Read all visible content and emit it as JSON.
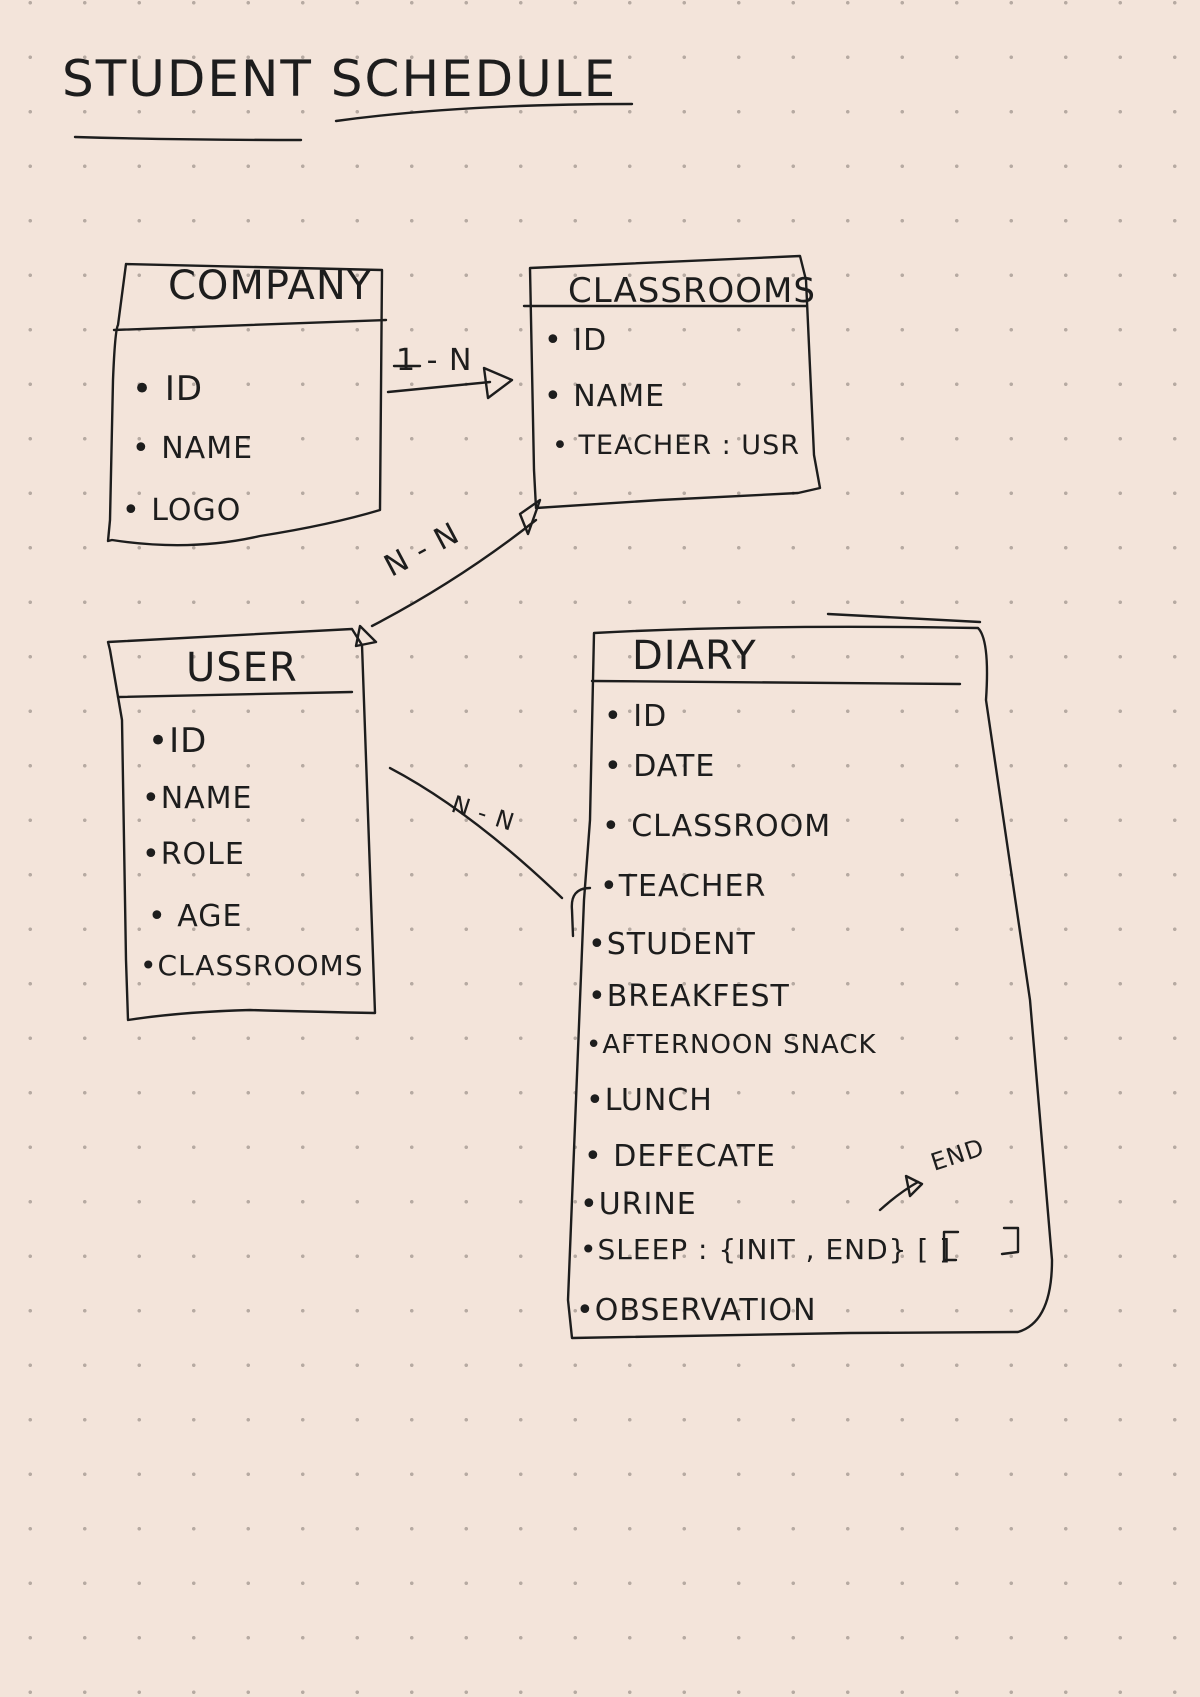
{
  "title": "STUDENT SCHEDULE",
  "entities": {
    "company": {
      "header": "COMPANY",
      "fields": [
        "ID",
        "NAME",
        "LOGO"
      ]
    },
    "classrooms": {
      "header": "CLASSROOMS",
      "fields": [
        "ID",
        "NAME",
        "TEACHER : USR"
      ]
    },
    "user": {
      "header": "USER",
      "fields": [
        "ID",
        "NAME",
        "ROLE",
        "AGE",
        "CLASSROOMS"
      ]
    },
    "diary": {
      "header": "DIARY",
      "fields": [
        "ID",
        "DATE",
        "CLASSROOM",
        "TEACHER",
        "STUDENT",
        "BREAKFEST",
        "AFTERNOON SNACK",
        "LUNCH",
        "DEFECATE",
        "URINE",
        "SLEEP : {INIT , END} [ ]",
        "OBSERVATION"
      ]
    }
  },
  "relationships": {
    "company_classrooms": "1 - N",
    "classrooms_user": "N - N",
    "user_diary": "N - N"
  },
  "annotations": {
    "sleep_end": "END"
  }
}
